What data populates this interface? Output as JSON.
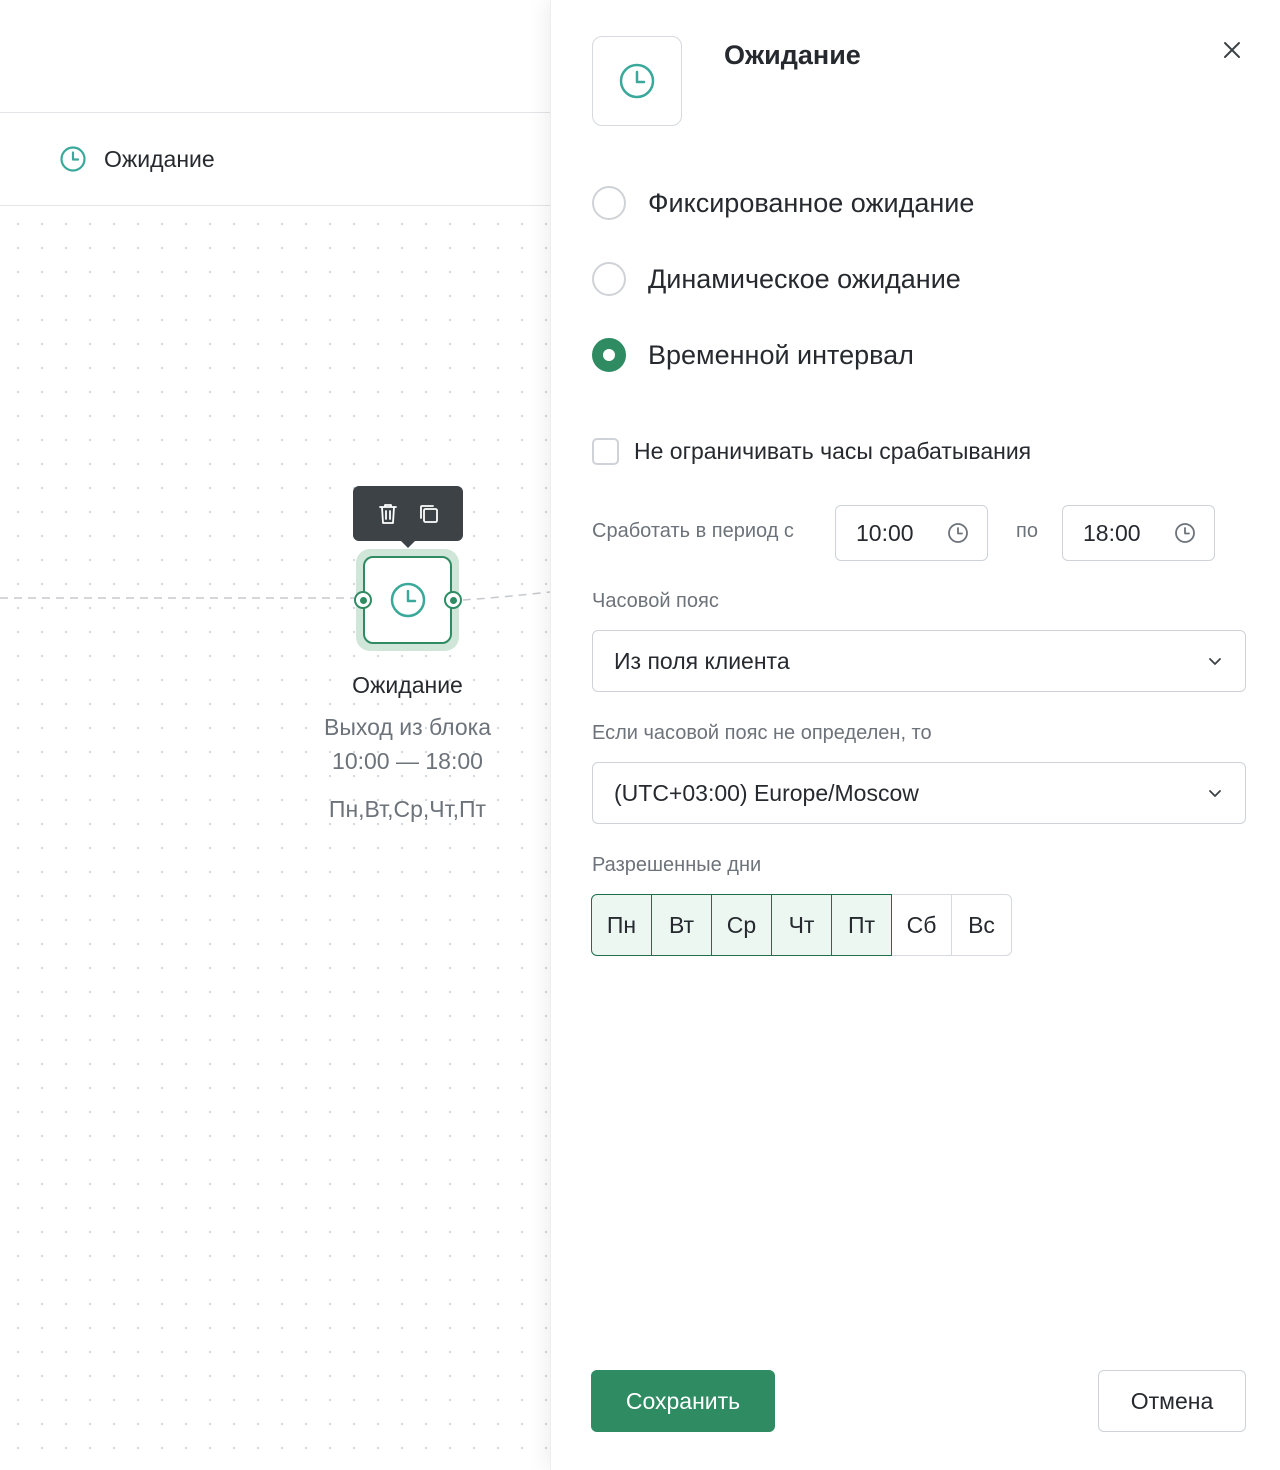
{
  "canvas": {
    "breadcrumb_label": "Ожидание",
    "node": {
      "title": "Ожидание",
      "subtitle": "Выход из блока",
      "time_range": "10:00 — 18:00",
      "days": "Пн,Вт,Ср,Чт,Пт"
    }
  },
  "panel": {
    "title": "Ожидание",
    "wait_types": [
      {
        "label": "Фиксированное ожидание",
        "checked": false
      },
      {
        "label": "Динамическое ожидание",
        "checked": false
      },
      {
        "label": "Временной интервал",
        "checked": true
      }
    ],
    "unlimited_hours_label": "Не ограничивать часы срабатывания",
    "unlimited_hours_checked": false,
    "period_label": "Сработать в период с",
    "period_from": "10:00",
    "period_to_label": "по",
    "period_to": "18:00",
    "timezone_label": "Часовой пояс",
    "timezone_value": "Из поля клиента",
    "fallback_label": "Если часовой пояс не определен, то",
    "fallback_value": "(UTC+03:00) Europe/Moscow",
    "allowed_days_label": "Разрешенные дни",
    "days": [
      {
        "label": "Пн",
        "selected": true
      },
      {
        "label": "Вт",
        "selected": true
      },
      {
        "label": "Ср",
        "selected": true
      },
      {
        "label": "Чт",
        "selected": true
      },
      {
        "label": "Пт",
        "selected": true
      },
      {
        "label": "Сб",
        "selected": false
      },
      {
        "label": "Вс",
        "selected": false
      }
    ],
    "save_label": "Сохранить",
    "cancel_label": "Отмена"
  },
  "colors": {
    "accent": "#2e8b62",
    "icon_teal": "#3aa89a",
    "day_selected_bg": "#ecf7f1"
  }
}
